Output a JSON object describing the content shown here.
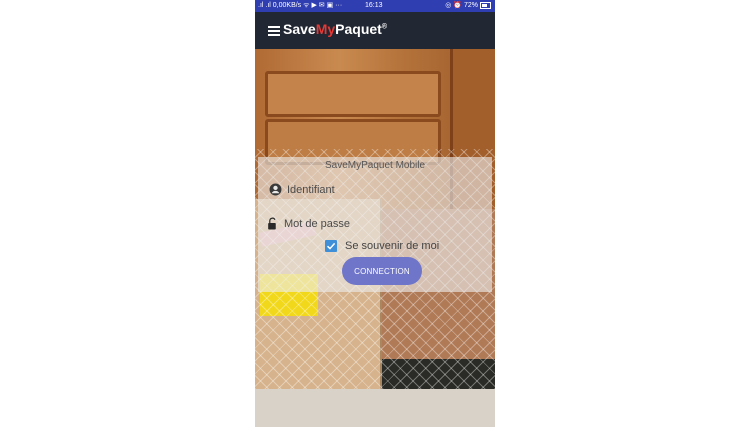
{
  "status_bar": {
    "left": ".ıl .ıl 0,00KB/s ᯤ ▶ ✉ ▣ ···",
    "time": "16:13",
    "right": "◎ ⏰ 72%"
  },
  "app_bar": {
    "brand_prefix": "Save",
    "brand_highlight": "My",
    "brand_suffix": "Paquet",
    "brand_reg": "®",
    "menu_icon": "hamburger-menu-icon"
  },
  "login": {
    "title": "SaveMyPaquet Mobile",
    "username_placeholder": "Identifiant",
    "username_icon": "account-circle-icon",
    "password_placeholder": "Mot de passe",
    "password_icon": "unlock-icon",
    "remember_label": "Se souvenir de moi",
    "remember_checked": true,
    "connect_label": "CONNECTION"
  },
  "colors": {
    "status_bar": "#2f3eb0",
    "app_bar": "#212733",
    "brand_accent": "#e53935",
    "button": "#6f75c9",
    "checkbox": "#3f8ed8"
  }
}
